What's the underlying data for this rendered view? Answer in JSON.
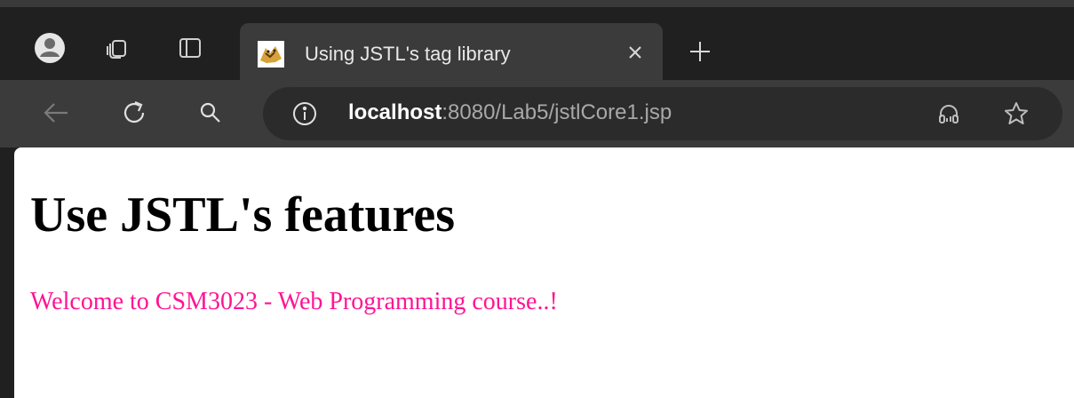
{
  "browser": {
    "tab": {
      "title": "Using JSTL's tag library"
    },
    "address_bar": {
      "host": "localhost",
      "path": ":8080/Lab5/jstlCore1.jsp"
    },
    "icons": {
      "profile": "profile-avatar-icon",
      "workspaces": "workspaces-icon",
      "tab_actions": "tab-actions-icon",
      "favicon": "tomcat-favicon-icon",
      "close": "close-icon",
      "new_tab": "plus-icon",
      "back": "back-arrow-icon",
      "refresh": "refresh-icon",
      "search": "search-icon",
      "info": "info-icon",
      "read_aloud": "headphones-icon",
      "favorite": "star-icon"
    },
    "colors": {
      "frame": "#202020",
      "toolbar": "#3b3b3b",
      "address_bg": "#2b2b2b"
    }
  },
  "page": {
    "heading": "Use JSTL's features",
    "welcome_message": "Welcome to CSM3023 - Web Programming course..!",
    "welcome_color": "#ff1493"
  }
}
